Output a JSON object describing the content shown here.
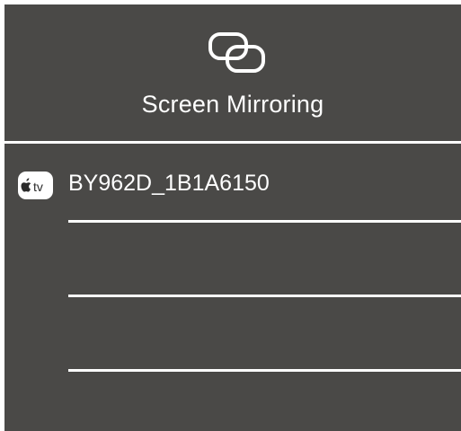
{
  "screen": {
    "title": "Screen Mirroring",
    "icon": "screen-mirroring-icon"
  },
  "devices": [
    {
      "name": "BY962D_1B1A6150",
      "icon": "apple-tv-icon",
      "icon_label": "tv"
    },
    {
      "name": ""
    },
    {
      "name": ""
    }
  ],
  "colors": {
    "background": "#4a4947",
    "foreground": "#ffffff"
  }
}
